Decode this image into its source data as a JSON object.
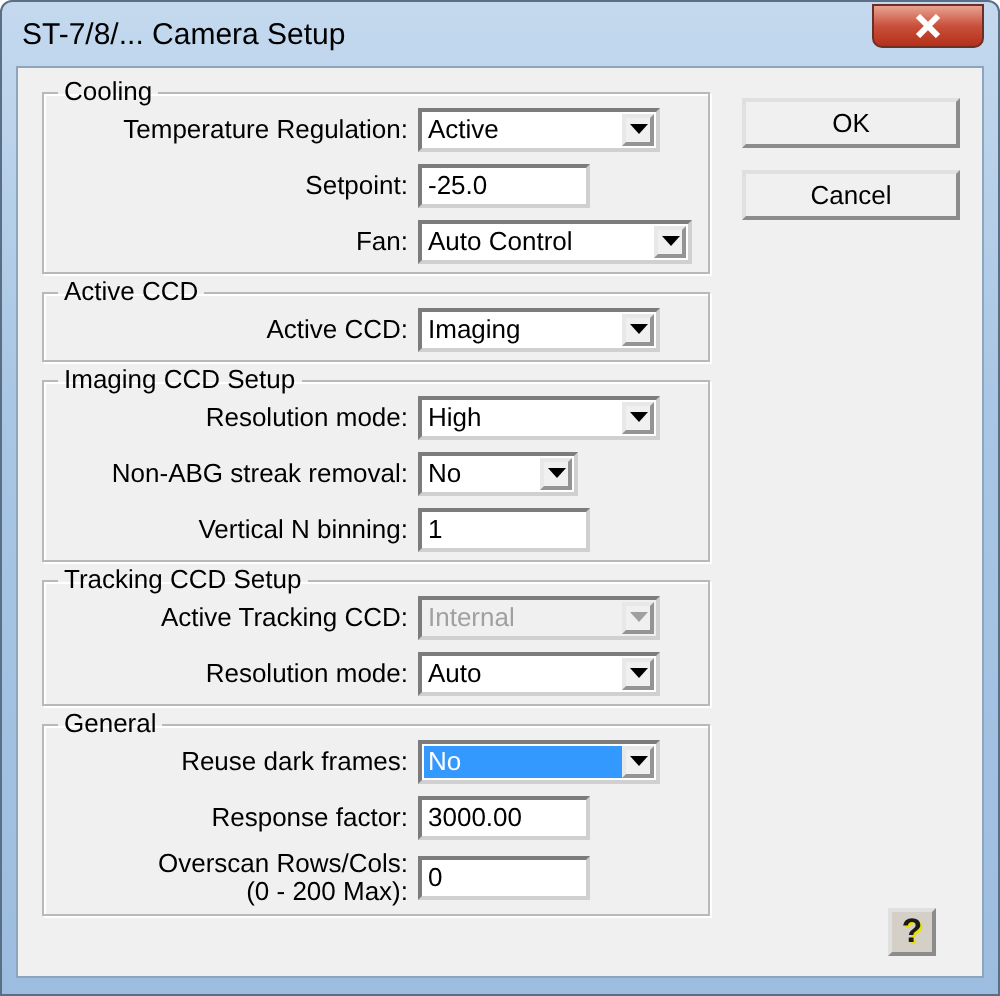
{
  "window": {
    "title": "ST-7/8/... Camera Setup"
  },
  "groups": [
    {
      "title": "Cooling",
      "fields": [
        {
          "kind": "combo",
          "label": "Temperature Regulation:",
          "value": "Active",
          "disabled": false,
          "selected": false
        },
        {
          "kind": "edit",
          "label": "Setpoint:",
          "value": "-25.0"
        },
        {
          "kind": "combo",
          "label": "Fan:",
          "value": "Auto Control",
          "disabled": false,
          "selected": false
        }
      ]
    },
    {
      "title": "Active CCD",
      "fields": [
        {
          "kind": "combo",
          "label": "Active CCD:",
          "value": "Imaging",
          "disabled": false,
          "selected": false
        }
      ]
    },
    {
      "title": "Imaging CCD Setup",
      "fields": [
        {
          "kind": "combo",
          "label": "Resolution mode:",
          "value": "High",
          "disabled": false,
          "selected": false
        },
        {
          "kind": "combo",
          "label": "Non-ABG streak removal:",
          "value": "No",
          "disabled": false,
          "selected": false
        },
        {
          "kind": "edit",
          "label": "Vertical N binning:",
          "value": "1"
        }
      ]
    },
    {
      "title": "Tracking CCD Setup",
      "fields": [
        {
          "kind": "combo",
          "label": "Active Tracking CCD:",
          "value": "Internal",
          "disabled": true,
          "selected": false
        },
        {
          "kind": "combo",
          "label": "Resolution mode:",
          "value": "Auto",
          "disabled": false,
          "selected": false
        }
      ]
    },
    {
      "title": "General",
      "fields": [
        {
          "kind": "combo",
          "label": "Reuse dark frames:",
          "value": "No",
          "disabled": false,
          "selected": true
        },
        {
          "kind": "edit",
          "label": "Response factor:",
          "value": "3000.00"
        },
        {
          "kind": "edit",
          "label": "Overscan Rows/Cols:\n(0 - 200 Max):",
          "value": "0"
        }
      ]
    }
  ],
  "buttons": [
    "OK",
    "Cancel"
  ],
  "help_button": "?"
}
